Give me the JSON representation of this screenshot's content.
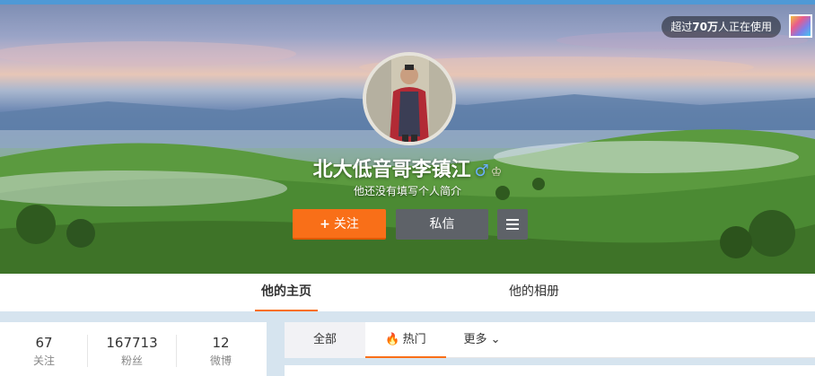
{
  "cover": {
    "usage_prefix": "超过",
    "usage_count": "70万",
    "usage_suffix": "人正在使用",
    "qr_icon": "qr-code-icon"
  },
  "profile": {
    "name": "北大低音哥李镇江",
    "gender_symbol": "♂",
    "level_symbol": "♔",
    "bio": "他还没有填写个人简介"
  },
  "actions": {
    "follow_plus": "+",
    "follow_label": "关注",
    "message_label": "私信",
    "menu_icon": "menu-icon"
  },
  "tabs": [
    {
      "label": "他的主页",
      "active": true
    },
    {
      "label": "他的相册",
      "active": false
    }
  ],
  "stats": [
    {
      "value": "67",
      "label": "关注"
    },
    {
      "value": "167713",
      "label": "粉丝"
    },
    {
      "value": "12",
      "label": "微博"
    }
  ],
  "feed_tabs": {
    "all": "全部",
    "hot": "热门",
    "hot_icon": "🔥",
    "more": "更多",
    "more_arrow": "⌄"
  },
  "colors": {
    "accent": "#f96f18",
    "button_dark": "#5e6268",
    "top_bar": "#4f99d6"
  }
}
